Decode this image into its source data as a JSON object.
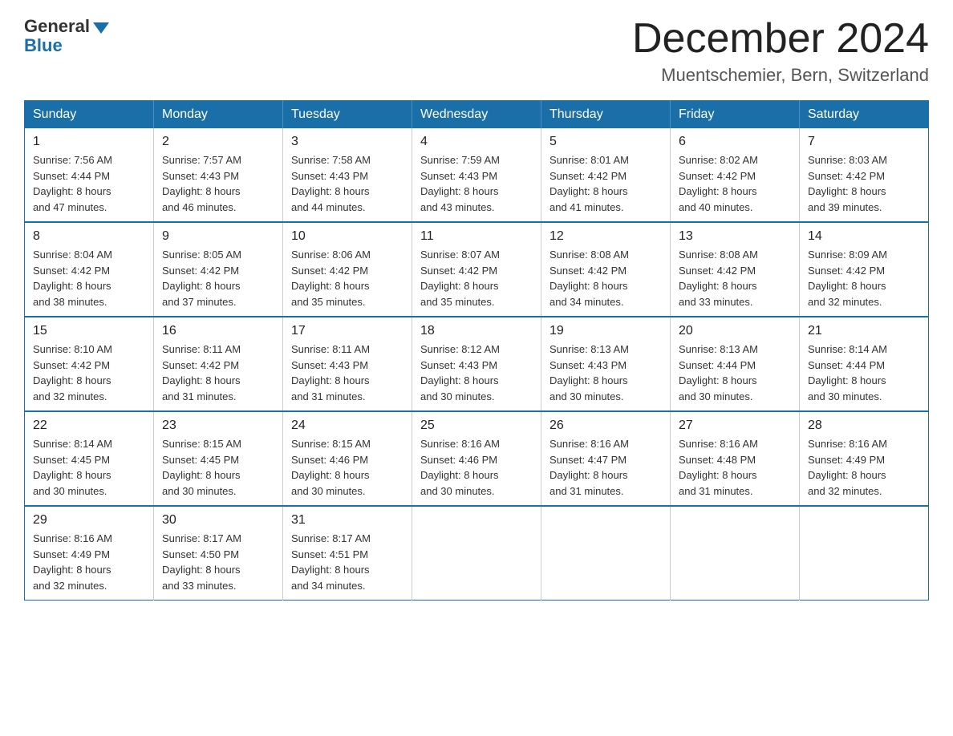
{
  "header": {
    "logo_general": "General",
    "logo_blue": "Blue",
    "month_title": "December 2024",
    "location": "Muentschemier, Bern, Switzerland"
  },
  "days_of_week": [
    "Sunday",
    "Monday",
    "Tuesday",
    "Wednesday",
    "Thursday",
    "Friday",
    "Saturday"
  ],
  "weeks": [
    [
      {
        "day": "1",
        "sunrise": "7:56 AM",
        "sunset": "4:44 PM",
        "daylight": "8 hours and 47 minutes."
      },
      {
        "day": "2",
        "sunrise": "7:57 AM",
        "sunset": "4:43 PM",
        "daylight": "8 hours and 46 minutes."
      },
      {
        "day": "3",
        "sunrise": "7:58 AM",
        "sunset": "4:43 PM",
        "daylight": "8 hours and 44 minutes."
      },
      {
        "day": "4",
        "sunrise": "7:59 AM",
        "sunset": "4:43 PM",
        "daylight": "8 hours and 43 minutes."
      },
      {
        "day": "5",
        "sunrise": "8:01 AM",
        "sunset": "4:42 PM",
        "daylight": "8 hours and 41 minutes."
      },
      {
        "day": "6",
        "sunrise": "8:02 AM",
        "sunset": "4:42 PM",
        "daylight": "8 hours and 40 minutes."
      },
      {
        "day": "7",
        "sunrise": "8:03 AM",
        "sunset": "4:42 PM",
        "daylight": "8 hours and 39 minutes."
      }
    ],
    [
      {
        "day": "8",
        "sunrise": "8:04 AM",
        "sunset": "4:42 PM",
        "daylight": "8 hours and 38 minutes."
      },
      {
        "day": "9",
        "sunrise": "8:05 AM",
        "sunset": "4:42 PM",
        "daylight": "8 hours and 37 minutes."
      },
      {
        "day": "10",
        "sunrise": "8:06 AM",
        "sunset": "4:42 PM",
        "daylight": "8 hours and 35 minutes."
      },
      {
        "day": "11",
        "sunrise": "8:07 AM",
        "sunset": "4:42 PM",
        "daylight": "8 hours and 35 minutes."
      },
      {
        "day": "12",
        "sunrise": "8:08 AM",
        "sunset": "4:42 PM",
        "daylight": "8 hours and 34 minutes."
      },
      {
        "day": "13",
        "sunrise": "8:08 AM",
        "sunset": "4:42 PM",
        "daylight": "8 hours and 33 minutes."
      },
      {
        "day": "14",
        "sunrise": "8:09 AM",
        "sunset": "4:42 PM",
        "daylight": "8 hours and 32 minutes."
      }
    ],
    [
      {
        "day": "15",
        "sunrise": "8:10 AM",
        "sunset": "4:42 PM",
        "daylight": "8 hours and 32 minutes."
      },
      {
        "day": "16",
        "sunrise": "8:11 AM",
        "sunset": "4:42 PM",
        "daylight": "8 hours and 31 minutes."
      },
      {
        "day": "17",
        "sunrise": "8:11 AM",
        "sunset": "4:43 PM",
        "daylight": "8 hours and 31 minutes."
      },
      {
        "day": "18",
        "sunrise": "8:12 AM",
        "sunset": "4:43 PM",
        "daylight": "8 hours and 30 minutes."
      },
      {
        "day": "19",
        "sunrise": "8:13 AM",
        "sunset": "4:43 PM",
        "daylight": "8 hours and 30 minutes."
      },
      {
        "day": "20",
        "sunrise": "8:13 AM",
        "sunset": "4:44 PM",
        "daylight": "8 hours and 30 minutes."
      },
      {
        "day": "21",
        "sunrise": "8:14 AM",
        "sunset": "4:44 PM",
        "daylight": "8 hours and 30 minutes."
      }
    ],
    [
      {
        "day": "22",
        "sunrise": "8:14 AM",
        "sunset": "4:45 PM",
        "daylight": "8 hours and 30 minutes."
      },
      {
        "day": "23",
        "sunrise": "8:15 AM",
        "sunset": "4:45 PM",
        "daylight": "8 hours and 30 minutes."
      },
      {
        "day": "24",
        "sunrise": "8:15 AM",
        "sunset": "4:46 PM",
        "daylight": "8 hours and 30 minutes."
      },
      {
        "day": "25",
        "sunrise": "8:16 AM",
        "sunset": "4:46 PM",
        "daylight": "8 hours and 30 minutes."
      },
      {
        "day": "26",
        "sunrise": "8:16 AM",
        "sunset": "4:47 PM",
        "daylight": "8 hours and 31 minutes."
      },
      {
        "day": "27",
        "sunrise": "8:16 AM",
        "sunset": "4:48 PM",
        "daylight": "8 hours and 31 minutes."
      },
      {
        "day": "28",
        "sunrise": "8:16 AM",
        "sunset": "4:49 PM",
        "daylight": "8 hours and 32 minutes."
      }
    ],
    [
      {
        "day": "29",
        "sunrise": "8:16 AM",
        "sunset": "4:49 PM",
        "daylight": "8 hours and 32 minutes."
      },
      {
        "day": "30",
        "sunrise": "8:17 AM",
        "sunset": "4:50 PM",
        "daylight": "8 hours and 33 minutes."
      },
      {
        "day": "31",
        "sunrise": "8:17 AM",
        "sunset": "4:51 PM",
        "daylight": "8 hours and 34 minutes."
      },
      null,
      null,
      null,
      null
    ]
  ],
  "labels": {
    "sunrise": "Sunrise:",
    "sunset": "Sunset:",
    "daylight": "Daylight:"
  }
}
